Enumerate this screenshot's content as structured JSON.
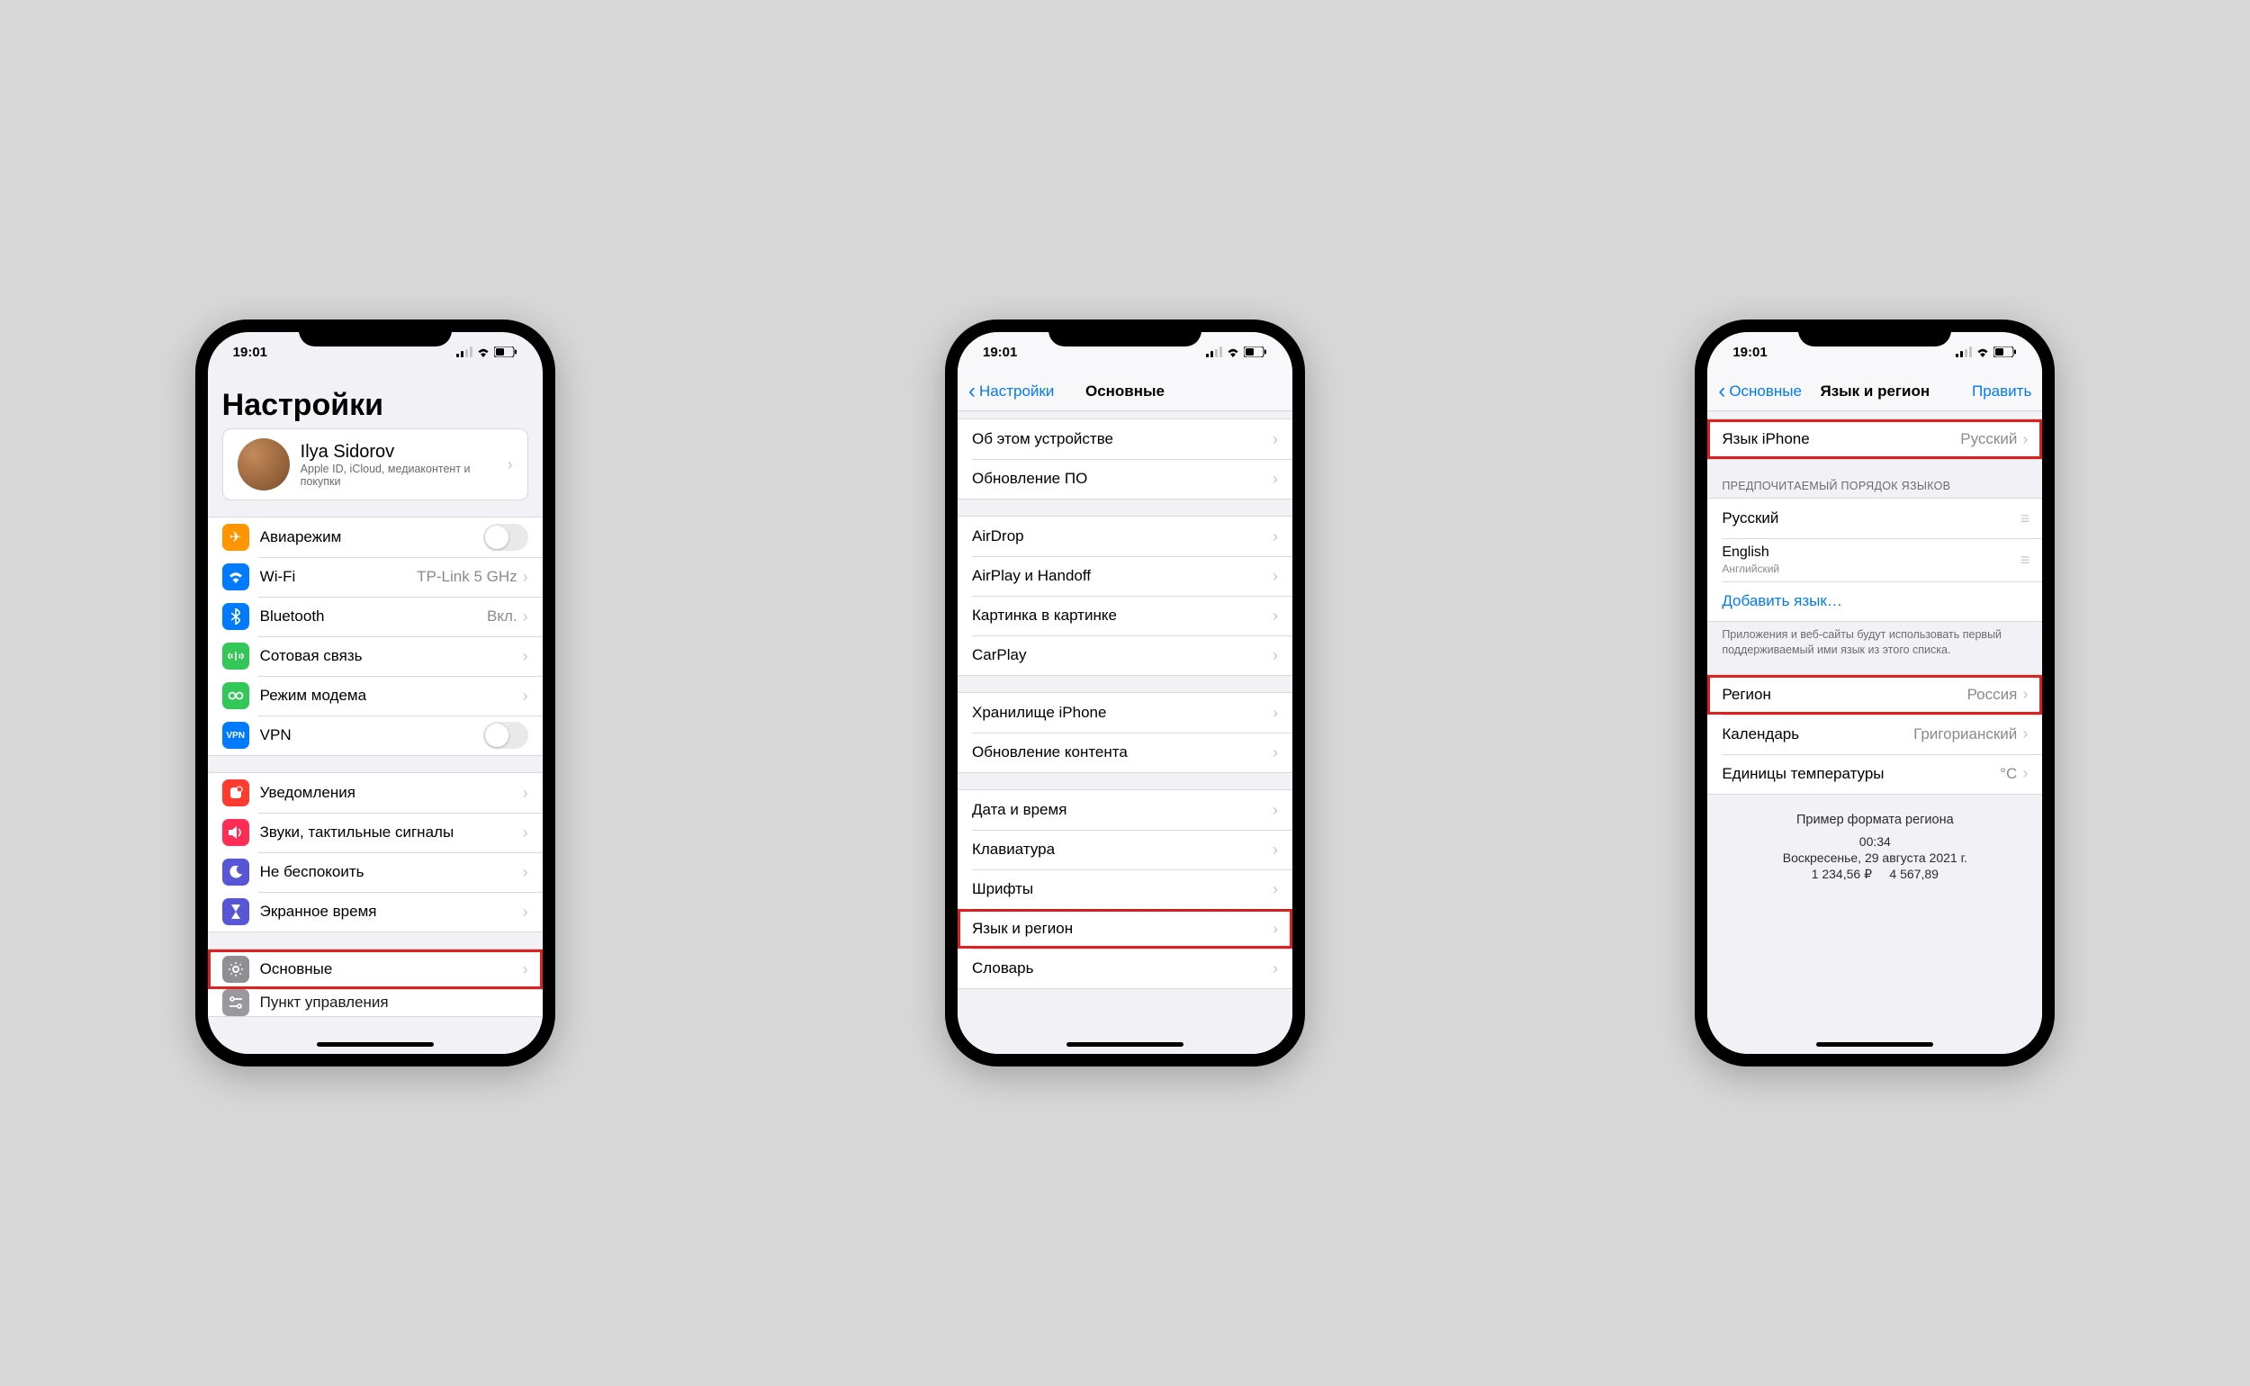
{
  "status": {
    "time": "19:01"
  },
  "screen1": {
    "title": "Настройки",
    "profile": {
      "name": "Ilya Sidorov",
      "sub": "Apple ID, iCloud, медиаконтент и покупки"
    },
    "grp1": {
      "airplane": "Авиарежим",
      "wifi": "Wi-Fi",
      "wifi_val": "TP-Link 5 GHz",
      "bt": "Bluetooth",
      "bt_val": "Вкл.",
      "cell": "Сотовая связь",
      "hotspot": "Режим модема",
      "vpn": "VPN"
    },
    "grp2": {
      "notif": "Уведомления",
      "sounds": "Звуки, тактильные сигналы",
      "dnd": "Не беспокоить",
      "screentime": "Экранное время"
    },
    "grp3": {
      "general": "Основные",
      "control": "Пункт управления"
    }
  },
  "screen2": {
    "back": "Настройки",
    "title": "Основные",
    "grp1": {
      "about": "Об этом устройстве",
      "update": "Обновление ПО"
    },
    "grp2": {
      "airdrop": "AirDrop",
      "airplay": "AirPlay и Handoff",
      "pip": "Картинка в картинке",
      "carplay": "CarPlay"
    },
    "grp3": {
      "storage": "Хранилище iPhone",
      "bgrefresh": "Обновление контента"
    },
    "grp4": {
      "datetime": "Дата и время",
      "keyboard": "Клавиатура",
      "fonts": "Шрифты",
      "lang": "Язык и регион",
      "dict": "Словарь"
    }
  },
  "screen3": {
    "back": "Основные",
    "title": "Язык и регион",
    "edit": "Править",
    "iphone_lang_label": "Язык iPhone",
    "iphone_lang_value": "Русский",
    "pref_header": "Предпочитаемый порядок языков",
    "langs": {
      "ru": "Русский",
      "en": "English",
      "en_sub": "Английский"
    },
    "add_lang": "Добавить язык…",
    "pref_footer": "Приложения и веб-сайты будут использовать первый поддерживаемый ими язык из этого списка.",
    "region_label": "Регион",
    "region_value": "Россия",
    "calendar_label": "Календарь",
    "calendar_value": "Григорианский",
    "temp_label": "Единицы температуры",
    "temp_value": "°C",
    "example": {
      "heading": "Пример формата региона",
      "time": "00:34",
      "date": "Воскресенье, 29 августа 2021 г.",
      "numbers": "1 234,56 ₽     4 567,89"
    }
  },
  "colors": {
    "orange": "#ff9500",
    "blue": "#007aff",
    "green": "#33c758",
    "darkgreen": "#33c758",
    "red": "#ff3b30",
    "pink": "#ff2d55",
    "indigo": "#5856d6",
    "purple": "#5856d6",
    "gray": "#8e8e93",
    "teal": "#2dbf9a"
  }
}
